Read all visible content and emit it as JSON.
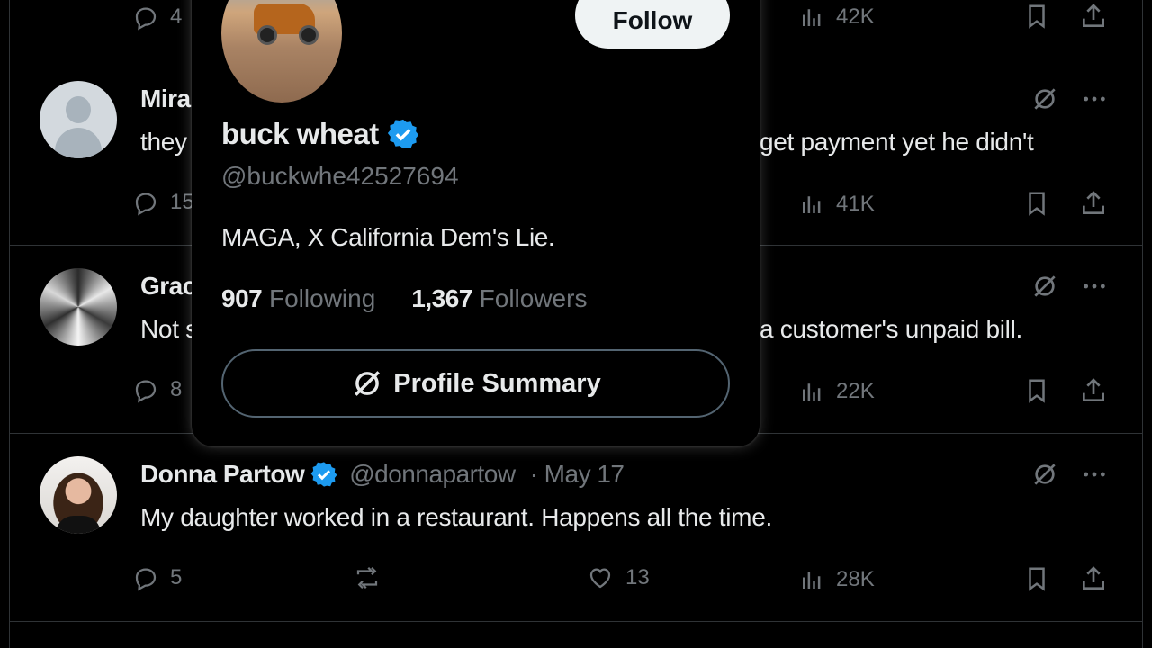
{
  "colors": {
    "background": "#000000",
    "text": "#e7e9ea",
    "muted": "#71767b",
    "verified": "#1d9bf0",
    "divider": "#2f3336"
  },
  "tweets": [
    {
      "name": "",
      "handle": "",
      "date": "",
      "text": "",
      "replies": "4",
      "views": "42K"
    },
    {
      "name": "Mira",
      "text_left": "they",
      "text_right": "get payment yet he didn't",
      "replies": "15",
      "views": "41K"
    },
    {
      "name": "Grac",
      "text_left": "Not s",
      "text_right": "a customer's unpaid bill.",
      "replies": "8",
      "views": "22K"
    },
    {
      "name": "Donna Partow",
      "handle": "@donnapartow",
      "date": "· May 17",
      "text": "My daughter worked in a restaurant. Happens all the time.",
      "replies": "5",
      "retweets": "",
      "likes": "13",
      "views": "28K"
    }
  ],
  "hovercard": {
    "follow_label": "Follow",
    "name": "buck wheat",
    "handle": "@buckwhe42527694",
    "bio": "MAGA, X California Dem's Lie.",
    "following_count": "907",
    "following_label": "Following",
    "followers_count": "1,367",
    "followers_label": "Followers",
    "summary_label": "Profile Summary"
  }
}
